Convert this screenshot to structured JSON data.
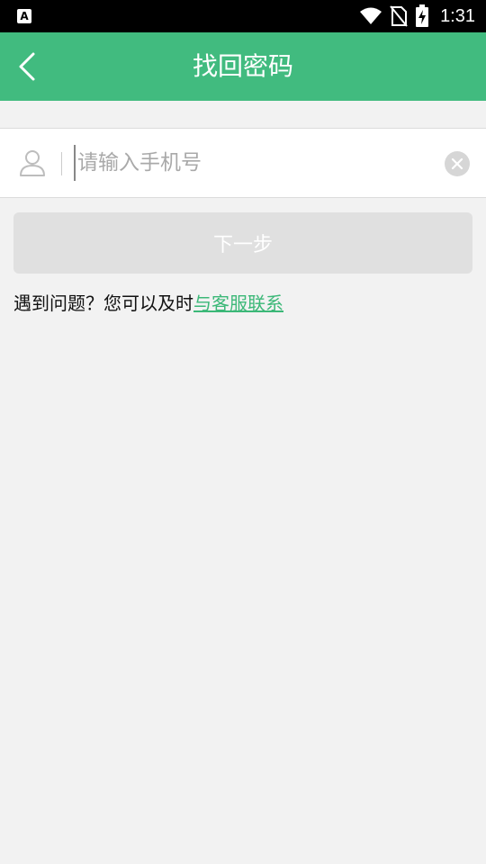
{
  "status_bar": {
    "time": "1:31",
    "icons": [
      "app-a-icon",
      "wifi-icon",
      "no-sim-icon",
      "battery-charging-icon"
    ]
  },
  "header": {
    "title": "找回密码",
    "back_icon": "chevron-left-icon",
    "background_color": "#41bb7f"
  },
  "phone_field": {
    "placeholder": "请输入手机号",
    "value": "",
    "leading_icon": "user-icon",
    "trailing_icon": "clear-icon"
  },
  "next_button": {
    "label": "下一步",
    "enabled": false
  },
  "help": {
    "text": "遇到问题？您可以及时",
    "link_text": "与客服联系",
    "link_color": "#3cb878"
  }
}
